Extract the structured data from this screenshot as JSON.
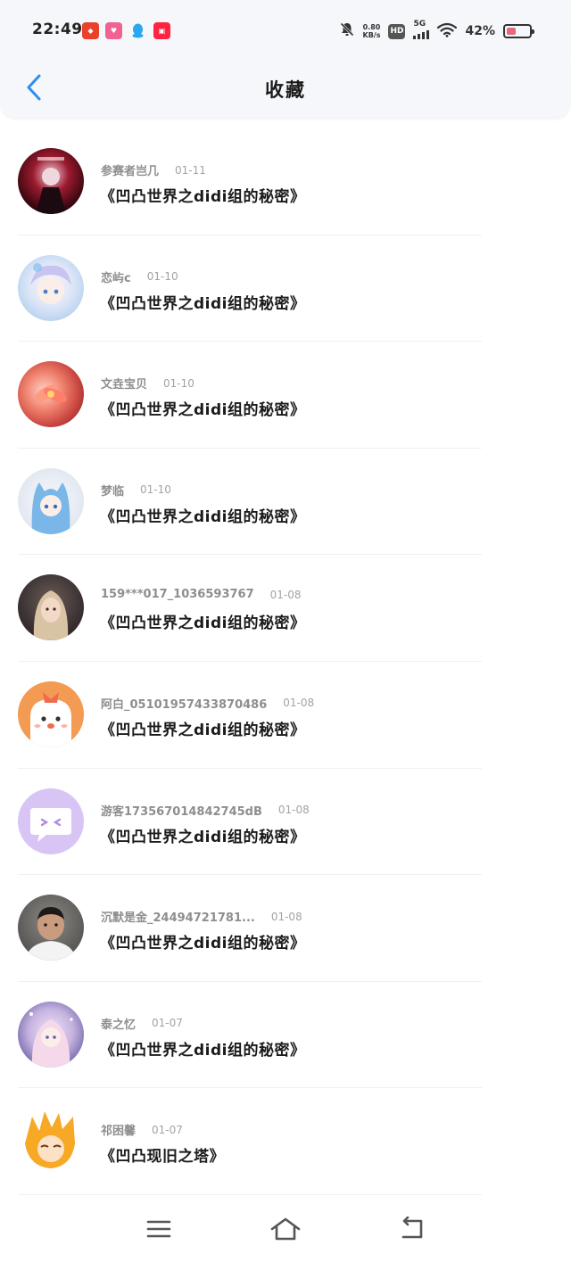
{
  "status_bar": {
    "time": "22:49",
    "net_speed_value": "0.80",
    "net_speed_unit": "KB/s",
    "hd": "HD",
    "network": "5G",
    "battery_percent": "42%",
    "battery_level": 0.42,
    "app_icons": [
      "pdd-app-icon",
      "lala-app-icon",
      "qq-app-icon",
      "xiaohongshu-app-icon"
    ]
  },
  "header": {
    "title": "收藏",
    "back_icon": "chevron-left-icon"
  },
  "items": [
    {
      "author": "参赛者岂几",
      "date": "01-11",
      "title": "《凹凸世界之didi组的秘密》"
    },
    {
      "author": "恋屿c",
      "date": "01-10",
      "title": "《凹凸世界之didi组的秘密》"
    },
    {
      "author": "文垚宝贝",
      "date": "01-10",
      "title": "《凹凸世界之didi组的秘密》"
    },
    {
      "author": "梦临",
      "date": "01-10",
      "title": "《凹凸世界之didi组的秘密》"
    },
    {
      "author": "159***017_1036593767",
      "date": "01-08",
      "title": "《凹凸世界之didi组的秘密》"
    },
    {
      "author": "阿白_05101957433870486",
      "date": "01-08",
      "title": "《凹凸世界之didi组的秘密》"
    },
    {
      "author": "游客173567014842745dB",
      "date": "01-08",
      "title": "《凹凸世界之didi组的秘密》"
    },
    {
      "author": "沉默是金_24494721781...",
      "date": "01-08",
      "title": "《凹凸世界之didi组的秘密》"
    },
    {
      "author": "泰之忆",
      "date": "01-07",
      "title": "《凹凸世界之didi组的秘密》"
    },
    {
      "author": "祁困馨",
      "date": "01-07",
      "title": "《凹凸现旧之塔》"
    }
  ],
  "bottom_nav": {
    "icons": [
      "menu-icon",
      "home-icon",
      "back-icon"
    ]
  },
  "colors": {
    "accent": "#2f8df0",
    "header_bg": "#f6f7fa",
    "meta_text": "#8e8e8e",
    "battery_fill": "#e46a7d"
  }
}
